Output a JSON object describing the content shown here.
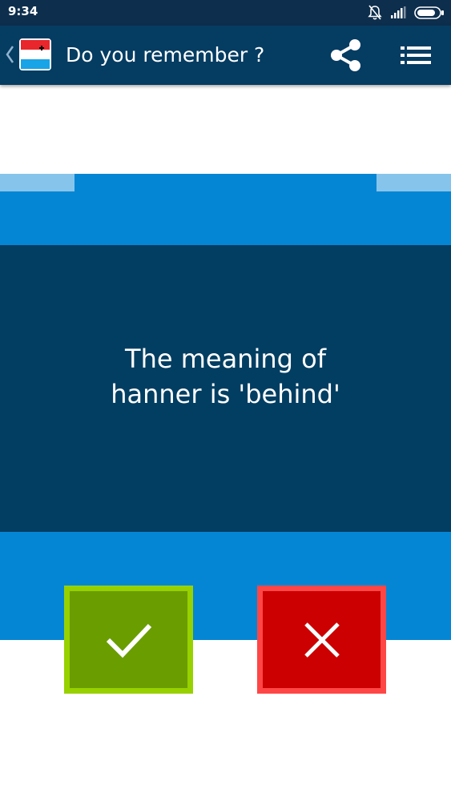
{
  "status_bar": {
    "time": "9:34",
    "icons": [
      "bell-off-icon",
      "signal-icon",
      "battery-icon"
    ]
  },
  "app_bar": {
    "title": "Do you remember ?",
    "back_icon": "chevron-left-icon",
    "flag_icon": "luxembourg-flag-icon",
    "actions": [
      "share-icon",
      "list-menu-icon"
    ]
  },
  "card": {
    "question": "The meaning of hanner is 'behind'"
  },
  "answers": {
    "correct_icon": "checkmark-icon",
    "wrong_icon": "close-icon"
  },
  "colors": {
    "status_bar": "#0d2e4d",
    "app_bar": "#053c62",
    "band": "#0586d4",
    "tab": "#86c4ec",
    "question_panel": "#023e62",
    "correct_fill": "#6a9d00",
    "correct_border": "#97d100",
    "wrong_fill": "#cc0000",
    "wrong_border": "#ff4646"
  }
}
